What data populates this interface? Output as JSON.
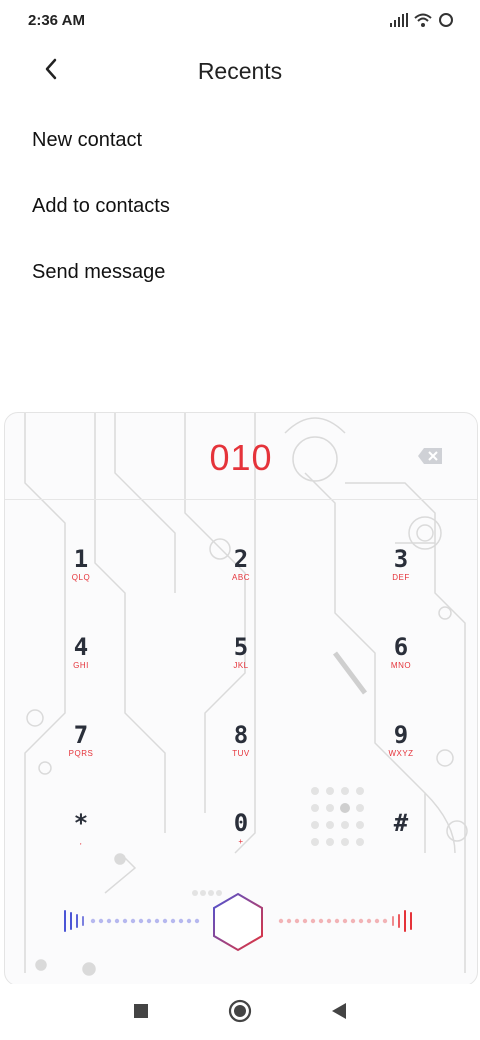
{
  "status_bar": {
    "time": "2:36 AM",
    "icons": [
      "signal-icon",
      "wifi-icon",
      "battery-circle-icon"
    ]
  },
  "header": {
    "back_icon": "chevron-left-icon",
    "title": "Recents"
  },
  "menu": {
    "items": [
      {
        "label": "New contact"
      },
      {
        "label": "Add to contacts"
      },
      {
        "label": "Send message"
      }
    ]
  },
  "dialer": {
    "number": "010",
    "backspace_icon": "backspace-icon",
    "keys": [
      {
        "digit": "1",
        "letters": "QLQ"
      },
      {
        "digit": "2",
        "letters": "ABC"
      },
      {
        "digit": "3",
        "letters": "DEF"
      },
      {
        "digit": "4",
        "letters": "GHI"
      },
      {
        "digit": "5",
        "letters": "JKL"
      },
      {
        "digit": "6",
        "letters": "MNO"
      },
      {
        "digit": "7",
        "letters": "PQRS"
      },
      {
        "digit": "8",
        "letters": "TUV"
      },
      {
        "digit": "9",
        "letters": "WXYZ"
      },
      {
        "digit": "*",
        "letters": ","
      },
      {
        "digit": "0",
        "letters": "+"
      },
      {
        "digit": "#",
        "letters": ""
      }
    ],
    "call_button_icon": "voice-call-icon",
    "accent_color": "#e5333a"
  },
  "navbar": {
    "icons": [
      "recent-apps-icon",
      "home-icon",
      "back-icon"
    ]
  }
}
